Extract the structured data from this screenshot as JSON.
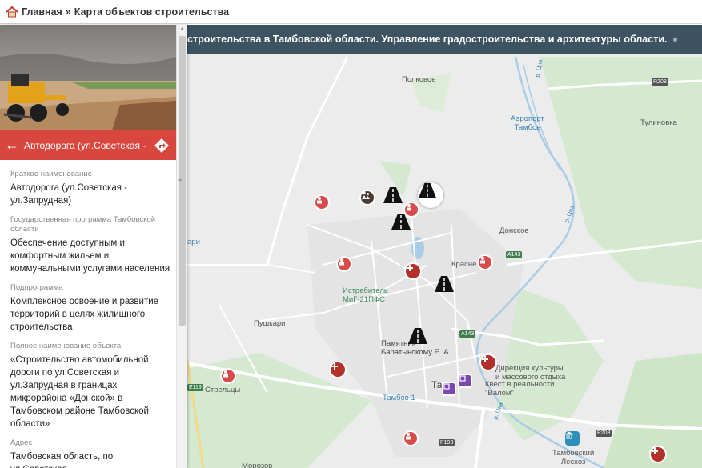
{
  "topbar": {
    "home_label": "Главная",
    "separator": "»",
    "page_title": "Карта объектов строительства"
  },
  "banner": {
    "text": "строительства в Тамбовской области. Управление градостроительства и архитектуры области."
  },
  "sidebar": {
    "object_title": "Автодорога (ул.Советская - ...",
    "fields": [
      {
        "label": "Краткое наименование",
        "value": "Автодорога (ул.Советская - ул.Запрудная)"
      },
      {
        "label": "Государственная программа Тамбовской области",
        "value": "Обеспечение доступным и комфортным жильем и коммунальными услугами населения"
      },
      {
        "label": "Подпрограмма",
        "value": "Комплексное освоение и развитие территорий в целях жилищного строительства"
      },
      {
        "label": "Полное наименование объекта",
        "value": "«Строительство автомобильной дороги по ул.Советская и ул.Запрудная в границах микрорайона «Донской» в Тамбовском районе Тамбовской области»"
      },
      {
        "label": "Адрес",
        "value": "Тамбовская область, по ул.Советская"
      }
    ]
  },
  "map": {
    "places": {
      "polkovoe": "Полковое",
      "airport": "Аэропорт\nТамбов",
      "tulinovka": "Тулиновка",
      "donskoe": "Донское",
      "krasnaya": "Красне",
      "istrebitel": "Истребитель\nМиГ-21ПФС",
      "pushkari": "Пушкари",
      "pamyatnik": "Памятник\nБаратынскому Е. А",
      "direkciya": "Дирекция культуры\nи массового отдыха",
      "kvest": "Квест в реальности\n\"Валом\"",
      "strelcy": "Стрельцы",
      "tambov1": "Тамбов 1",
      "tambov": "Там",
      "leshoz": "Тамбовский\nЛесхоз",
      "ari": "ари",
      "rcna1": "р. Цна",
      "rcna2": "р. Цна",
      "rcna3": "р. Цна",
      "morozov": "Морозов"
    },
    "shields": {
      "r208a": "R208",
      "r208b": "P208",
      "a143a": "A143",
      "a143b": "A143",
      "e119": "E119",
      "p193": "P193"
    }
  }
}
